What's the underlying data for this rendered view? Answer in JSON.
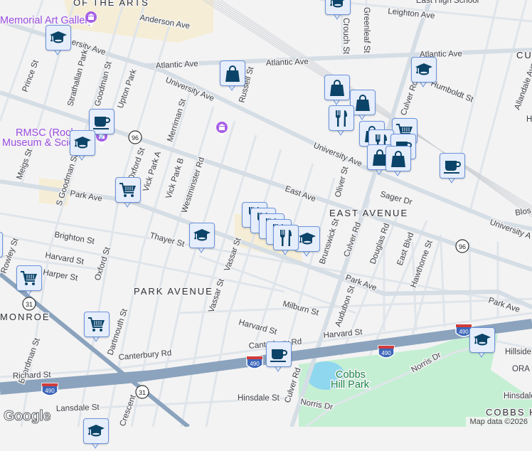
{
  "map": {
    "attribution": "Map data ©2026",
    "logo": "Google"
  },
  "areas": {
    "arts": "OF THE ARTS",
    "east_avenue": "EAST AVENUE",
    "park_avenue": "PARK AVENUE",
    "monroe": "MONROE",
    "cobbs_hill": "COBBS H",
    "ora": "ORA",
    "cul": "CUL",
    "east_high": "East High School"
  },
  "pois": {
    "memorial_art_gallery": "Memorial Art Gallery",
    "rmsc_1": "RMSC (Roch",
    "rmsc_2": "Museum & Scie",
    "cobbs_park_1": "Cobbs",
    "cobbs_park_2": "Hill Park"
  },
  "streets": {
    "anderson": "Anderson Ave",
    "university_1": "ersity Ave",
    "atlantic_1": "Atlantic Ave",
    "atlantic_2": "Atlantic Ave",
    "university_2": "University Ave",
    "university_3": "University Ave",
    "university_4": "University A",
    "blos": "Blos",
    "east_ave": "East Ave",
    "park_ave_1": "Park Ave",
    "park_ave_2": "Park Ave",
    "park_ave_3": "Park Ave",
    "prince": "Prince St",
    "strathallan": "Strathallan Park",
    "goodman": "Goodman St",
    "upton": "Upton Park",
    "meigs": "Meigs St",
    "s_goodman": "S Goodman St",
    "oxford_1": "Oxford St",
    "vick_a": "Vick Park A",
    "vick_b": "Vick Park B",
    "merriman": "Merriman St",
    "westminster": "Westminster Rd",
    "russell": "Russell St",
    "crouch": "Crouch St",
    "greenleaf": "Greenleaf St",
    "leighton": "Leighton Ave",
    "culver_1": "Culver Rd",
    "humboldt": "Humboldt St",
    "allandale": "Allandale Ave",
    "h": "H",
    "oliver": "Oliver St",
    "sager": "Sager Dr",
    "brighton": "Brighton St",
    "thayer": "Thayer St",
    "harvard_1": "Harvard St",
    "harper": "Harper St",
    "rowley": "Rowley St",
    "oxford_2": "Oxford St",
    "vassar_1": "Vassar St",
    "vassar_2": "Vassar St",
    "harvard_2": "Harvard St",
    "milburn": "Milburn St",
    "brunswick": "Brunswick St",
    "culver_2": "Culver Rd",
    "douglas": "Douglas Rd",
    "east_blvd": "East Blvd",
    "hawthorne": "Hawthorne St",
    "audubon": "Audubon St",
    "harvard_3": "Harvard St",
    "canterbury_1": "Canterbury Rd",
    "canterbury_2": "Canterbury Rd",
    "dartmouth": "Dartmouth St",
    "boardman": "Boardman St",
    "richard": "Richard St",
    "lansdale": "Lansdale St",
    "crescent": "Crescent",
    "hinsdale": "Hinsdale St",
    "culver_3": "Culver Rd",
    "norris_1": "Norris Dr",
    "norris_2": "Norris Dr",
    "hillside": "Hillside"
  },
  "shields": [
    "96",
    "96",
    "31",
    "31",
    "490",
    "490",
    "490",
    "490"
  ],
  "markers": [
    {
      "type": "education"
    },
    {
      "type": "shopping"
    },
    {
      "type": "cafe"
    },
    {
      "type": "education"
    },
    {
      "type": "grocery"
    },
    {
      "type": "education"
    },
    {
      "type": "shopping"
    },
    {
      "type": "shopping"
    },
    {
      "type": "restaurant"
    },
    {
      "type": "shopping"
    },
    {
      "type": "grocery"
    },
    {
      "type": "restaurant"
    },
    {
      "type": "cafe"
    },
    {
      "type": "shopping"
    },
    {
      "type": "shopping"
    },
    {
      "type": "cafe"
    },
    {
      "type": "education"
    },
    {
      "type": "restaurant"
    },
    {
      "type": "restaurant"
    },
    {
      "type": "restaurant"
    },
    {
      "type": "restaurant"
    },
    {
      "type": "education"
    },
    {
      "type": "restaurant"
    },
    {
      "type": "education"
    },
    {
      "type": "grocery"
    },
    {
      "type": "grocery"
    },
    {
      "type": "cafe"
    },
    {
      "type": "education"
    },
    {
      "type": "education"
    },
    {
      "type": "education"
    }
  ],
  "museum_pins": [
    "museum",
    "museum",
    "museum"
  ],
  "colors": {
    "background": "#f4f3f4",
    "road": "#d5dde5",
    "highway": "#8ba3bd",
    "park": "#c5efd3",
    "water": "#8fd7ef",
    "tan": "#f5edd5",
    "marker_fill": "#e6edfb",
    "marker_border": "#6b95db",
    "icon": "#0b4468",
    "museum": "#a55ee6"
  }
}
